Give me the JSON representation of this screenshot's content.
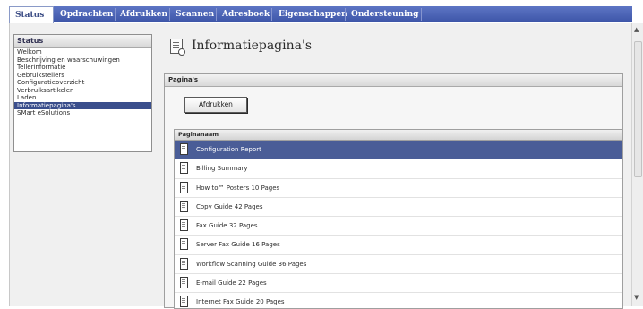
{
  "nav": {
    "tabs": [
      {
        "label": "Status",
        "active": true
      },
      {
        "label": "Opdrachten"
      },
      {
        "label": "Afdrukken"
      },
      {
        "label": "Scannen"
      },
      {
        "label": "Adresboek"
      },
      {
        "label": "Eigenschappen"
      },
      {
        "label": "Ondersteuning"
      }
    ]
  },
  "sidebar": {
    "heading": "Status",
    "items": [
      {
        "label": "Welkom"
      },
      {
        "label": "Beschrijving en waarschuwingen"
      },
      {
        "label": "Tellerinformatie"
      },
      {
        "label": "Gebruikstellers"
      },
      {
        "label": "Configuratieoverzicht"
      },
      {
        "label": "Verbruiksartikelen"
      },
      {
        "label": "Laden"
      },
      {
        "label": "Informatiepagina's",
        "selected": true
      },
      {
        "label": "SMart eSolutions"
      }
    ]
  },
  "main": {
    "title": "Informatiepagina's",
    "panel_heading": "Pagina's",
    "print_button": "Afdrukken",
    "table_header": "Paginanaam",
    "rows": [
      {
        "name": "Configuration Report",
        "selected": true
      },
      {
        "name": "Billing Summary"
      },
      {
        "name": "How to™ Posters 10 Pages"
      },
      {
        "name": "Copy Guide 42 Pages"
      },
      {
        "name": "Fax Guide 32 Pages"
      },
      {
        "name": "Server Fax Guide 16 Pages"
      },
      {
        "name": "Workflow Scanning Guide 36 Pages"
      },
      {
        "name": "E-mail Guide 22 Pages"
      },
      {
        "name": "Internet Fax Guide 20 Pages"
      }
    ]
  },
  "colors": {
    "nav_bar": "#4a62b6",
    "selected": "#4a5d97",
    "background": "#f0f0f0"
  },
  "icons": {
    "page_title": "info-page-icon",
    "row": "document-icon"
  }
}
